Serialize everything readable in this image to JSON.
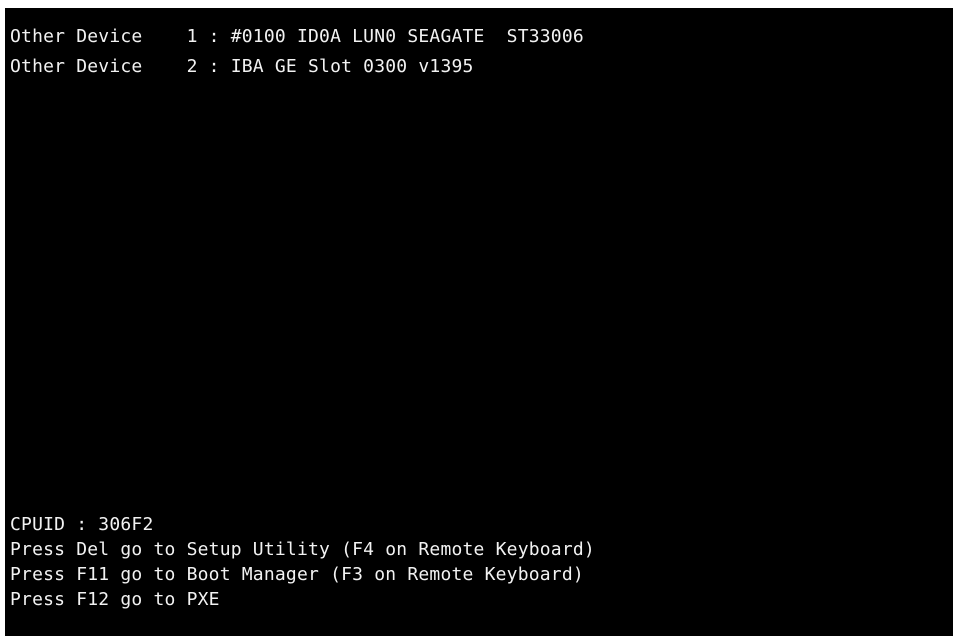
{
  "console": {
    "device_lines": [
      "Other Device    1 : #0100 ID0A LUN0 SEAGATE  ST33006",
      "Other Device    2 : IBA GE Slot 0300 v1395"
    ],
    "cpuid_line": "CPUID : 306F2",
    "prompts": [
      "Press Del go to Setup Utility (F4 on Remote Keyboard)",
      "Press F11 go to Boot Manager (F3 on Remote Keyboard)",
      "Press F12 go to PXE"
    ]
  },
  "colors": {
    "background": "#000000",
    "text": "#f2f2f2"
  }
}
